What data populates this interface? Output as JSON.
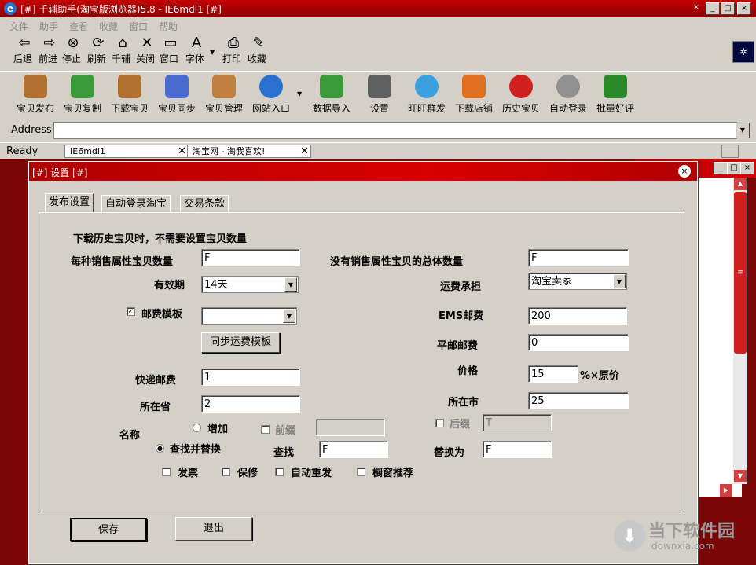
{
  "window": {
    "title": "[#] 千辅助手(淘宝版浏览器)5.8 - IE6mdi1 [#]",
    "controls": [
      "×",
      "_",
      "□",
      "×"
    ]
  },
  "menu": [
    "文件",
    "助手",
    "查看",
    "收藏",
    "窗口",
    "帮助"
  ],
  "toolbar1": [
    {
      "label": "后退",
      "icon": "back-arrow-icon",
      "glyph": "⇦"
    },
    {
      "label": "前进",
      "icon": "forward-arrow-icon",
      "glyph": "⇨"
    },
    {
      "label": "停止",
      "icon": "stop-icon",
      "glyph": "⊗"
    },
    {
      "label": "刷新",
      "icon": "refresh-icon",
      "glyph": "⟳"
    },
    {
      "label": "千辅",
      "icon": "home-icon",
      "glyph": "⌂"
    },
    {
      "label": "关闭",
      "icon": "close-icon",
      "glyph": "✕"
    },
    {
      "label": "窗口",
      "icon": "window-icon",
      "glyph": "▭"
    },
    {
      "label": "字体",
      "icon": "font-icon",
      "glyph": "A"
    },
    {
      "label": "打印",
      "icon": "print-icon",
      "glyph": "⎙"
    },
    {
      "label": "收藏",
      "icon": "favorite-icon",
      "glyph": "✎"
    }
  ],
  "toolbar2": [
    {
      "label": "宝贝发布",
      "icon": "publish-icon",
      "color": "#b07030"
    },
    {
      "label": "宝贝复制",
      "icon": "copy-icon",
      "color": "#3a9a3a"
    },
    {
      "label": "下载宝贝",
      "icon": "download-icon",
      "color": "#b07030"
    },
    {
      "label": "宝贝同步",
      "icon": "sync-icon",
      "color": "#4a6ad0"
    },
    {
      "label": "宝贝管理",
      "icon": "manage-icon",
      "color": "#c08040"
    },
    {
      "label": "网站入口",
      "icon": "ie-icon",
      "color": "#2a70d0"
    },
    {
      "label": "数据导入",
      "icon": "import-icon",
      "color": "#3a9a3a"
    },
    {
      "label": "设置",
      "icon": "settings-icon",
      "color": "#606060"
    },
    {
      "label": "旺旺群发",
      "icon": "wangwang-icon",
      "color": "#3aa0e0"
    },
    {
      "label": "下载店铺",
      "icon": "download-shop-icon",
      "color": "#e07020"
    },
    {
      "label": "历史宝贝",
      "icon": "history-icon",
      "color": "#d02020"
    },
    {
      "label": "自动登录",
      "icon": "auto-login-icon",
      "color": "#909090"
    },
    {
      "label": "批量好评",
      "icon": "batch-review-icon",
      "color": "#2a8a2a"
    }
  ],
  "address": {
    "label": "Address",
    "value": ""
  },
  "status": {
    "text": "Ready",
    "tab1": "IE6mdi1",
    "tab2": "淘宝网 - 淘我喜欢!"
  },
  "dialog": {
    "title": "[#] 设置 [#]",
    "tabs": [
      "发布设置",
      "自动登录淘宝",
      "交易条款"
    ],
    "note": "下载历史宝贝时，不需要设置宝贝数量",
    "fields": {
      "per_attr_qty_label": "每种销售属性宝贝数量",
      "per_attr_qty": "F",
      "no_attr_qty_label": "没有销售属性宝贝的总体数量",
      "no_attr_qty": "F",
      "validity_label": "有效期",
      "validity": "14天",
      "shipping_label": "运费承担",
      "shipping": "淘宝卖家",
      "postage_tpl_label": "邮费模板",
      "postage_tpl": "",
      "ems_label": "EMS邮费",
      "ems": "200",
      "sync_btn": "同步运费模板",
      "normal_mail_label": "平邮邮费",
      "normal_mail": "0",
      "price_label": "价格",
      "price": "15",
      "price_suffix": "%×原价",
      "express_label": "快递邮费",
      "express": "1",
      "province_label": "所在省",
      "province": "2",
      "city_label": "所在市",
      "city": "25",
      "name_label": "名称",
      "add_label": "增加",
      "prefix_label": "前缀",
      "prefix": "",
      "suffix_label": "后缀",
      "suffix": "T",
      "replace_label": "查找并替换",
      "find_label": "查找",
      "find": "F",
      "replace_with_label": "替换为",
      "replace_with": "F",
      "invoice_label": "发票",
      "warranty_label": "保修",
      "auto_repost_label": "自动重发",
      "window_recommend_label": "橱窗推荐"
    },
    "save_btn": "保存",
    "exit_btn": "退出"
  },
  "watermark": {
    "title": "当下软件园",
    "url": "downxia.com"
  }
}
